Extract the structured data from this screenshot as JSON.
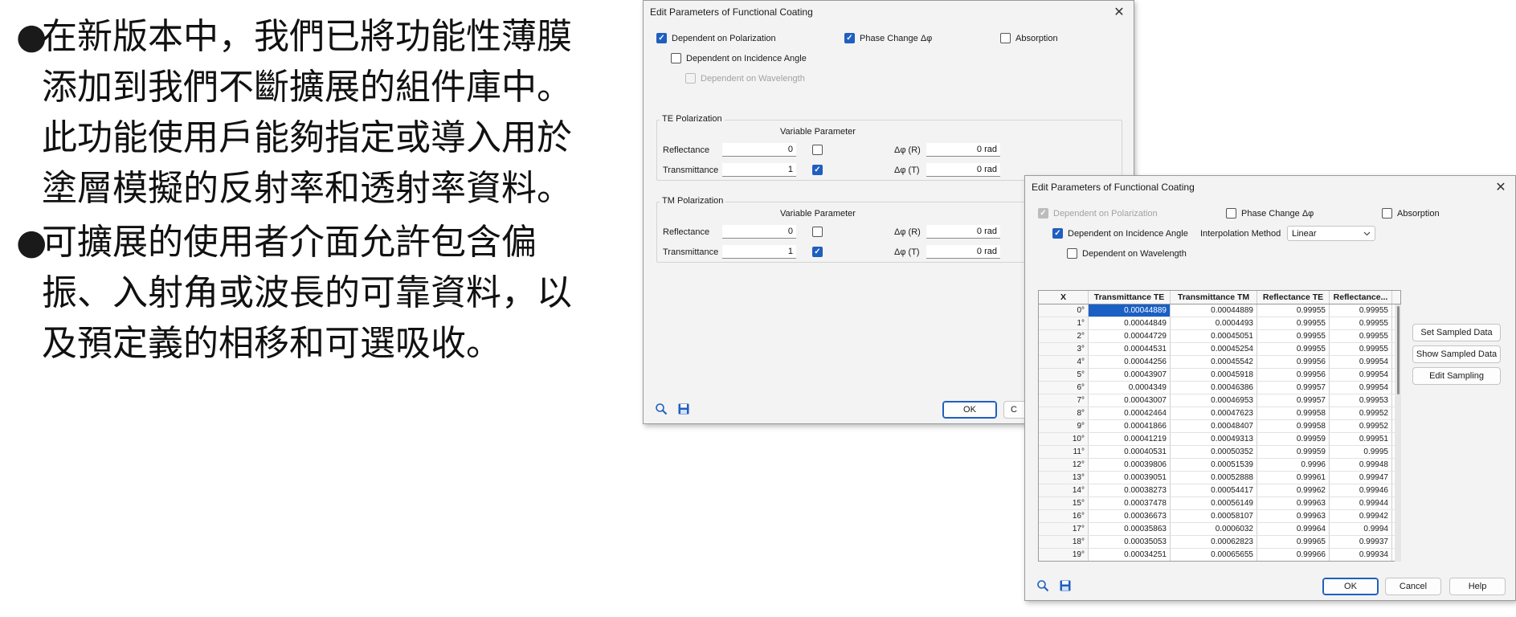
{
  "slide": {
    "bullets": [
      "在新版本中，我們已將功能性薄膜添加到我們不斷擴展的組件庫中。 此功能使用戶能夠指定或導入用於塗層模擬的反射率和透射率資料。",
      "可擴展的使用者介面允許包含偏振、入射角或波長的可靠資料，以及預定義的相移和可選吸收。"
    ],
    "bullet_glyph": "●"
  },
  "dialog1": {
    "title": "Edit Parameters of Functional Coating",
    "close_glyph": "✕",
    "checkboxes": {
      "polarization": {
        "label": "Dependent on Polarization",
        "checked": true
      },
      "phase_change": {
        "label": "Phase Change Δφ",
        "checked": true
      },
      "absorption": {
        "label": "Absorption",
        "checked": false
      },
      "incidence": {
        "label": "Dependent on Incidence Angle",
        "checked": false
      },
      "wavelength": {
        "label": "Dependent on Wavelength",
        "checked": false,
        "disabled": true
      }
    },
    "te": {
      "group_label": "TE Polarization",
      "variable_parameter": "Variable Parameter",
      "reflectance_label": "Reflectance",
      "reflectance_value": "0",
      "reflectance_variable": false,
      "transmittance_label": "Transmittance",
      "transmittance_value": "1",
      "transmittance_variable": true,
      "dphi_r_label": "Δφ (R)",
      "dphi_r_value": "0 rad",
      "dphi_t_label": "Δφ (T)",
      "dphi_t_value": "0 rad"
    },
    "tm": {
      "group_label": "TM Polarization",
      "variable_parameter": "Variable Parameter",
      "reflectance_label": "Reflectance",
      "reflectance_value": "0",
      "reflectance_variable": false,
      "transmittance_label": "Transmittance",
      "transmittance_value": "1",
      "transmittance_variable": true,
      "dphi_r_label": "Δφ (R)",
      "dphi_r_value": "0 rad",
      "dphi_t_label": "Δφ (T)",
      "dphi_t_value": "0 rad"
    },
    "ok_label": "OK",
    "cancel_partial": "C"
  },
  "dialog2": {
    "title": "Edit Parameters of Functional Coating",
    "close_glyph": "✕",
    "checkboxes": {
      "polarization": {
        "label": "Dependent on Polarization",
        "checked": true,
        "disabled": true
      },
      "phase_change": {
        "label": "Phase Change Δφ",
        "checked": false
      },
      "absorption": {
        "label": "Absorption",
        "checked": false
      },
      "incidence": {
        "label": "Dependent on Incidence Angle",
        "checked": true
      },
      "wavelength": {
        "label": "Dependent on Wavelength",
        "checked": false
      }
    },
    "interpolation_label": "Interpolation Method",
    "interpolation_value": "Linear",
    "table": {
      "columns": [
        "X",
        "Transmittance TE",
        "Transmittance TM",
        "Reflectance TE",
        "Reflectance..."
      ],
      "rows": [
        [
          "0°",
          "0.00044889",
          "0.00044889",
          "0.99955",
          "0.99955"
        ],
        [
          "1°",
          "0.00044849",
          "0.0004493",
          "0.99955",
          "0.99955"
        ],
        [
          "2°",
          "0.00044729",
          "0.00045051",
          "0.99955",
          "0.99955"
        ],
        [
          "3°",
          "0.00044531",
          "0.00045254",
          "0.99955",
          "0.99955"
        ],
        [
          "4°",
          "0.00044256",
          "0.00045542",
          "0.99956",
          "0.99954"
        ],
        [
          "5°",
          "0.00043907",
          "0.00045918",
          "0.99956",
          "0.99954"
        ],
        [
          "6°",
          "0.0004349",
          "0.00046386",
          "0.99957",
          "0.99954"
        ],
        [
          "7°",
          "0.00043007",
          "0.00046953",
          "0.99957",
          "0.99953"
        ],
        [
          "8°",
          "0.00042464",
          "0.00047623",
          "0.99958",
          "0.99952"
        ],
        [
          "9°",
          "0.00041866",
          "0.00048407",
          "0.99958",
          "0.99952"
        ],
        [
          "10°",
          "0.00041219",
          "0.00049313",
          "0.99959",
          "0.99951"
        ],
        [
          "11°",
          "0.00040531",
          "0.00050352",
          "0.99959",
          "0.9995"
        ],
        [
          "12°",
          "0.00039806",
          "0.00051539",
          "0.9996",
          "0.99948"
        ],
        [
          "13°",
          "0.00039051",
          "0.00052888",
          "0.99961",
          "0.99947"
        ],
        [
          "14°",
          "0.00038273",
          "0.00054417",
          "0.99962",
          "0.99946"
        ],
        [
          "15°",
          "0.00037478",
          "0.00056149",
          "0.99963",
          "0.99944"
        ],
        [
          "16°",
          "0.00036673",
          "0.00058107",
          "0.99963",
          "0.99942"
        ],
        [
          "17°",
          "0.00035863",
          "0.0006032",
          "0.99964",
          "0.9994"
        ],
        [
          "18°",
          "0.00035053",
          "0.00062823",
          "0.99965",
          "0.99937"
        ],
        [
          "19°",
          "0.00034251",
          "0.00065655",
          "0.99966",
          "0.99934"
        ]
      ]
    },
    "side_buttons": [
      "Set Sampled Data",
      "Show Sampled Data",
      "Edit Sampling"
    ],
    "ok_label": "OK",
    "cancel_label": "Cancel",
    "help_label": "Help"
  },
  "icons": {
    "zoom": "magnifier-icon",
    "save": "floppy-disk-icon",
    "dropdown": "chevron-down-icon"
  },
  "colors": {
    "accent": "#1f5fbf",
    "selection": "#1a5fc4",
    "dialog_bg": "#f3f3f3"
  }
}
